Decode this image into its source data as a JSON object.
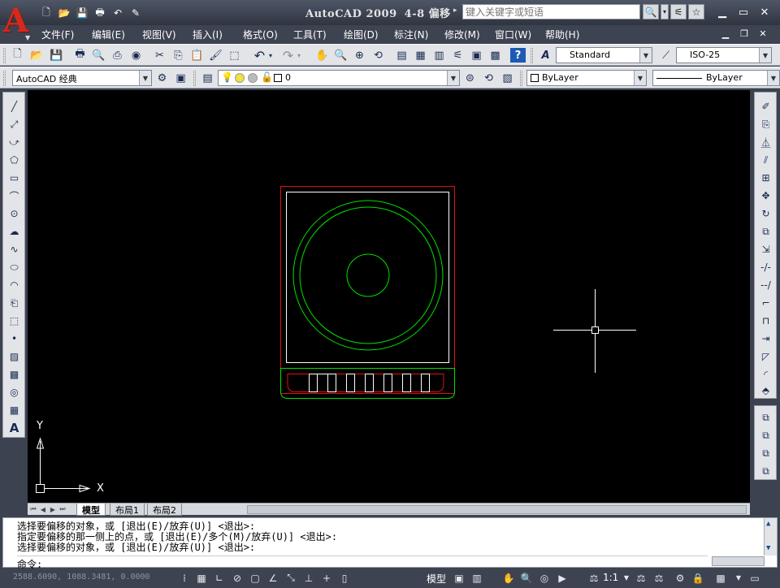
{
  "titlebar": {
    "app_title": "AutoCAD 2009",
    "doc_title": "4-8 偏移",
    "search_placeholder": "键入关键字或短语"
  },
  "menu": [
    "文件(F)",
    "编辑(E)",
    "视图(V)",
    "插入(I)",
    "格式(O)",
    "工具(T)",
    "绘图(D)",
    "标注(N)",
    "修改(M)",
    "窗口(W)",
    "帮助(H)"
  ],
  "toolbar1": {
    "text_style": "Standard",
    "dim_style": "ISO-25"
  },
  "toolbar2": {
    "workspace": "AutoCAD 经典",
    "layer": "0",
    "color": "ByLayer",
    "linetype": "ByLayer"
  },
  "colors": {
    "background": "#3c4250",
    "canvas": "#000000",
    "outer_frame": "#e01010",
    "inner_frame": "#ffffff",
    "circles": "#00e000",
    "logo": "#d42a1e"
  },
  "canvas": {
    "ucs_x": "X",
    "ucs_y": "Y"
  },
  "layout_tabs": [
    "模型",
    "布局1",
    "布局2"
  ],
  "command": {
    "history": [
      "选择要偏移的对象，或 [退出(E)/放弃(U)] <退出>:",
      "指定要偏移的那一侧上的点，或 [退出(E)/多个(M)/放弃(U)] <退出>:",
      "选择要偏移的对象，或 [退出(E)/放弃(U)] <退出>:"
    ],
    "prompt": "命令:"
  },
  "status": {
    "coordinates": "2588.6090, 1088.3481, 0.0000",
    "model_label": "模型",
    "annotation_scale": "1:1"
  }
}
